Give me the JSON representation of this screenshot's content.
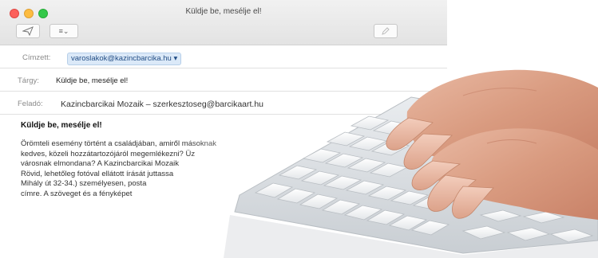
{
  "window": {
    "title": "Küldje be, mesélje el!"
  },
  "toolbar": {
    "send_icon": "paper-plane-icon",
    "format_icon": "list-format-icon",
    "right_icon": "compose-icon",
    "format_label": "≡⌄"
  },
  "header": {
    "to_label": "Címzett:",
    "to_value": "varoslakok@kazincbarcika.hu",
    "to_caret": "▾",
    "subject_label": "Tárgy:",
    "subject_value": "Küldje be, mesélje el!",
    "from_label": "Feladó:",
    "from_value": "Kazincbarcikai Mozaik – szerkesztoseg@barcikaart.hu"
  },
  "body": {
    "heading": "Küldje be, mesélje el!",
    "lines": [
      "Örömteli esemény történt a családjában, amiről másoknak",
      "kedves, közeli hozzátartozójáról megemlékezni? Üz",
      "városnak elmondana? A Kazincbarcikai Mozaik",
      "Rövid, lehetőleg fotóval ellátott írását juttassa",
      "Mihály út 32-34.) személyesen, posta",
      "címre. A szöveget és a fényképet"
    ]
  },
  "colors": {
    "accent": "#dbe9f8",
    "close": "#fc605b",
    "minimize": "#fdbc40",
    "zoom": "#34c84a"
  }
}
